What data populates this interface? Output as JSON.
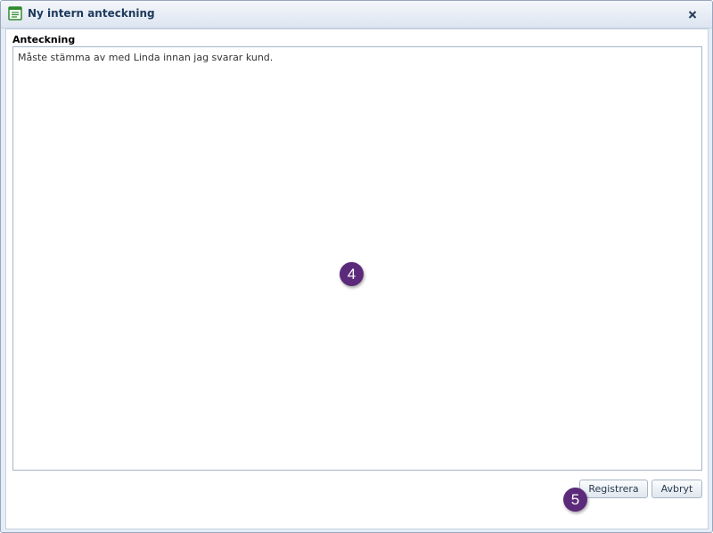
{
  "dialog": {
    "title": "Ny intern anteckning",
    "icon": "note-icon",
    "close_icon": "close-icon"
  },
  "form": {
    "note_label": "Anteckning",
    "note_value": "Måste stämma av med Linda innan jag svarar kund."
  },
  "buttons": {
    "register_label": "Registrera",
    "cancel_label": "Avbryt"
  },
  "annotations": {
    "step_4": "4",
    "step_5": "5"
  },
  "colors": {
    "title_text": "#1e3a5c",
    "badge": "#5c2a7a",
    "icon_green": "#2f8a2f"
  }
}
